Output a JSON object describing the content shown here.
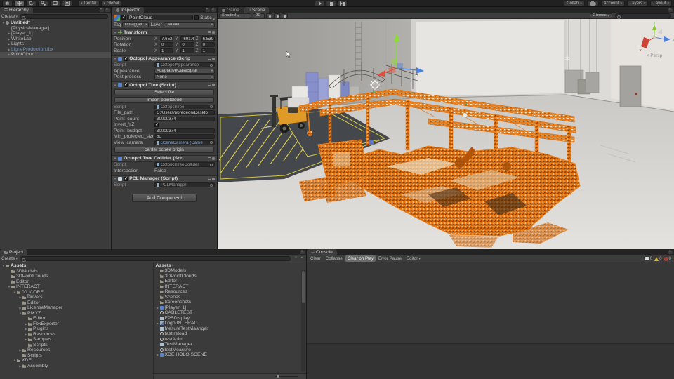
{
  "topbar": {
    "pivot_center": "Center",
    "pivot_global": "Global",
    "menu_collab": "Collab",
    "menu_account": "Account",
    "menu_layers": "Layers",
    "menu_layout": "Layout"
  },
  "hierarchy": {
    "tab": "Hierarchy",
    "create": "Create",
    "items": [
      {
        "label": "Untitled*",
        "arrow": "▼",
        "depth": 0,
        "bold": true,
        "icon": "scene"
      },
      {
        "label": "[PhysicsManager]",
        "depth": 1
      },
      {
        "label": "[Player_1]",
        "arrow": "▶",
        "depth": 1
      },
      {
        "label": "WhiteLab",
        "arrow": "▶",
        "depth": 1
      },
      {
        "label": "Lights",
        "arrow": "▶",
        "depth": 1
      },
      {
        "label": "LigneProduction.fbx",
        "arrow": "▶",
        "depth": 1,
        "color": "#6d94c4"
      },
      {
        "label": "PointCloud",
        "arrow": "▶",
        "depth": 1,
        "selected": true
      }
    ]
  },
  "inspector": {
    "tab": "Inspector",
    "name": "PointCloud",
    "static_label": "Static",
    "tag_label": "Tag",
    "tag": "Untagged",
    "layer_label": "Layer",
    "layer": "Default",
    "transform": {
      "title": "Transform",
      "position_label": "Position",
      "rotation_label": "Rotation",
      "scale_label": "Scale",
      "x": "X",
      "y": "Y",
      "z": "Z",
      "position": {
        "x": "7.65233",
        "y": "-691.44",
        "z": "6.53943"
      },
      "rotation": {
        "x": "0",
        "y": "0",
        "z": "0"
      },
      "scale": {
        "x": "1",
        "y": "1",
        "z": "1"
      }
    },
    "appearance": {
      "title": "Octopcl Appearance (Scrip",
      "script_label": "Script",
      "script": "OctopclAppearance",
      "appearance_label": "Appearance",
      "appearance": "AdaptativeCaseSplat",
      "post_label": "Post process",
      "post": "None"
    },
    "tree": {
      "title": "Octopcl Tree (Script)",
      "btn_select": "Select file",
      "btn_import": "import pointcloud",
      "script_label": "Script",
      "script": "OctopclTree",
      "file_path_label": "File_path",
      "file_path": "C:/Users/pbregeon/Deskto",
      "point_count_label": "Point_count",
      "point_count": "30009374",
      "invert_label": "Invert_YZ",
      "budget_label": "Point_budget",
      "budget": "30009374",
      "minsize_label": "Min_projected_size",
      "minsize": "80",
      "camera_label": "View_camera",
      "camera": "SceneCamera (Came",
      "btn_center": "center octree origin"
    },
    "collider": {
      "title": "Octopcl Tree Collider (Scri",
      "script_label": "Script",
      "script": "OctopclTreeCollider",
      "intersection_label": "Intersection",
      "intersection": "False"
    },
    "pcl": {
      "title": "PCL Manager (Script)",
      "script_label": "Script",
      "script": "PCLManager"
    },
    "add_component": "Add Component"
  },
  "scene": {
    "tab_game": "Game",
    "tab_scene": "Scene",
    "shading": "Shaded",
    "mode_2d": "2D",
    "gizmos": "Gizmos",
    "persp": "< Persp",
    "axis_x": "x",
    "axis_y": "y",
    "axis_z": "z"
  },
  "project": {
    "tab": "Project",
    "create": "Create",
    "breadcrumb": "Assets",
    "tree": [
      {
        "label": "Assets",
        "arrow": "▼",
        "depth": 0,
        "bold": true,
        "icon": "folder"
      },
      {
        "label": "3DModels",
        "depth": 1,
        "icon": "folder"
      },
      {
        "label": "3DPointClouds",
        "depth": 1,
        "icon": "folder"
      },
      {
        "label": "Editor",
        "depth": 1,
        "icon": "folder"
      },
      {
        "label": "INTERACT",
        "arrow": "▼",
        "depth": 1,
        "icon": "folder"
      },
      {
        "label": "00_CORE",
        "arrow": "▼",
        "depth": 2,
        "icon": "folder"
      },
      {
        "label": "Drivers",
        "arrow": "▶",
        "depth": 3,
        "icon": "folder"
      },
      {
        "label": "Editor",
        "depth": 3,
        "icon": "folder"
      },
      {
        "label": "LicenseManager",
        "arrow": "▶",
        "depth": 3,
        "icon": "folder"
      },
      {
        "label": "PiXYZ",
        "arrow": "▼",
        "depth": 3,
        "icon": "folder"
      },
      {
        "label": "Editor",
        "depth": 4,
        "icon": "folder"
      },
      {
        "label": "FbxExporter",
        "arrow": "▶",
        "depth": 4,
        "icon": "folder"
      },
      {
        "label": "Plugins",
        "arrow": "▶",
        "depth": 4,
        "icon": "folder"
      },
      {
        "label": "Resources",
        "arrow": "▶",
        "depth": 4,
        "icon": "folder"
      },
      {
        "label": "Samples",
        "arrow": "▶",
        "depth": 4,
        "icon": "folder"
      },
      {
        "label": "Scripts",
        "depth": 4,
        "icon": "folder"
      },
      {
        "label": "Resources",
        "arrow": "▶",
        "depth": 3,
        "icon": "folder"
      },
      {
        "label": "Scripts",
        "depth": 3,
        "icon": "folder"
      },
      {
        "label": "XDE",
        "arrow": "▼",
        "depth": 2,
        "icon": "folder"
      },
      {
        "label": "Assembly",
        "arrow": "▶",
        "depth": 3,
        "icon": "folder"
      }
    ],
    "list": [
      {
        "label": "3DModels",
        "icon": "folder"
      },
      {
        "label": "3DPointClouds",
        "icon": "folder"
      },
      {
        "label": "Editor",
        "icon": "folder"
      },
      {
        "label": "INTERACT",
        "icon": "folder"
      },
      {
        "label": "Resources",
        "icon": "folder"
      },
      {
        "label": "Scenes",
        "icon": "folder"
      },
      {
        "label": "Screenshots",
        "icon": "folder"
      },
      {
        "label": "[Player_1]",
        "icon": "cube",
        "arrow": "▶"
      },
      {
        "label": "CABLETEST",
        "icon": "cs"
      },
      {
        "label": "FPSDisplay",
        "icon": "doc"
      },
      {
        "label": "Logo INTERACT",
        "icon": "img",
        "arrow": "▶"
      },
      {
        "label": "MesureTestMaanger",
        "icon": "doc"
      },
      {
        "label": "test reload",
        "icon": "cs"
      },
      {
        "label": "testAnim",
        "icon": "cs"
      },
      {
        "label": "TestManager",
        "icon": "doc"
      },
      {
        "label": "testMeasure",
        "icon": "cs"
      },
      {
        "label": "XDE HOLO SCENE",
        "icon": "cube",
        "arrow": "▶"
      }
    ]
  },
  "console": {
    "tab": "Console",
    "btn_clear": "Clear",
    "btn_collapse": "Collapse",
    "btn_clear_on_play": "Clear on Play",
    "btn_error_pause": "Error Pause",
    "btn_editor": "Editor",
    "counts": {
      "info": "0",
      "warn": "0",
      "error": "0"
    }
  }
}
